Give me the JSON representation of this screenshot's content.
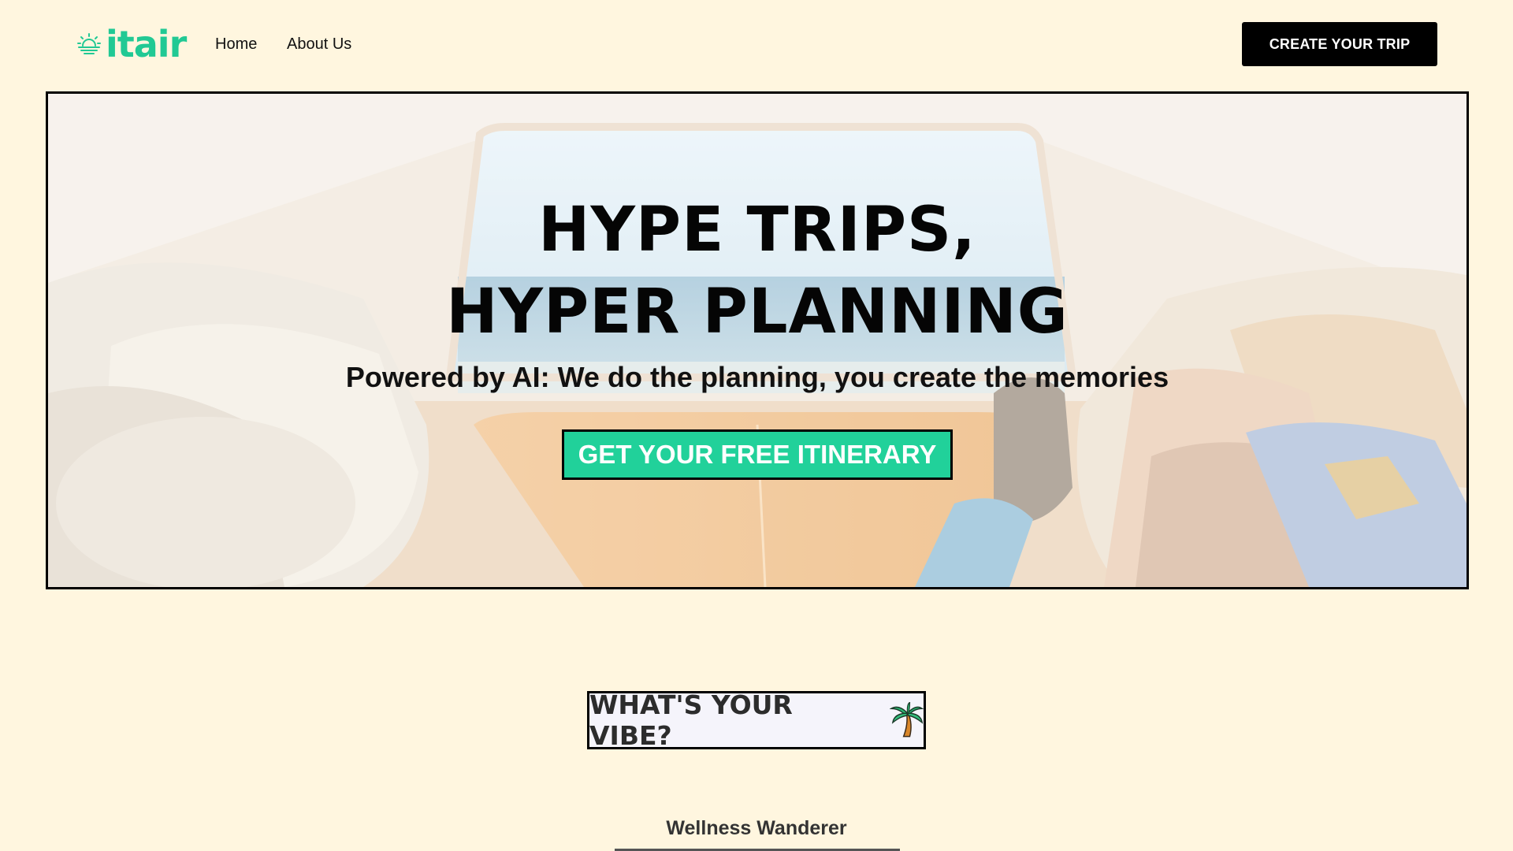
{
  "brand": {
    "name": "itair",
    "color": "#21c994",
    "icon": "sun-horizon-icon"
  },
  "nav": {
    "items": [
      {
        "label": "Home"
      },
      {
        "label": "About Us"
      }
    ],
    "cta_label": "CREATE YOUR TRIP"
  },
  "hero": {
    "title_line1": "HYPE TRIPS,",
    "title_line2": "HYPER PLANNING",
    "subtitle": "Powered by AI: We do the planning, you create the memories",
    "cta_label": "GET YOUR FREE ITINERARY",
    "cta_color": "#21d19a",
    "background": "van-interior-beach-photo"
  },
  "vibe": {
    "heading": "WHAT'S YOUR VIBE?",
    "icon": "palm-tree-icon",
    "first_card_title": "Wellness Wanderer"
  },
  "colors": {
    "page_bg": "#fff6df",
    "accent": "#21c994",
    "dark": "#000000"
  }
}
